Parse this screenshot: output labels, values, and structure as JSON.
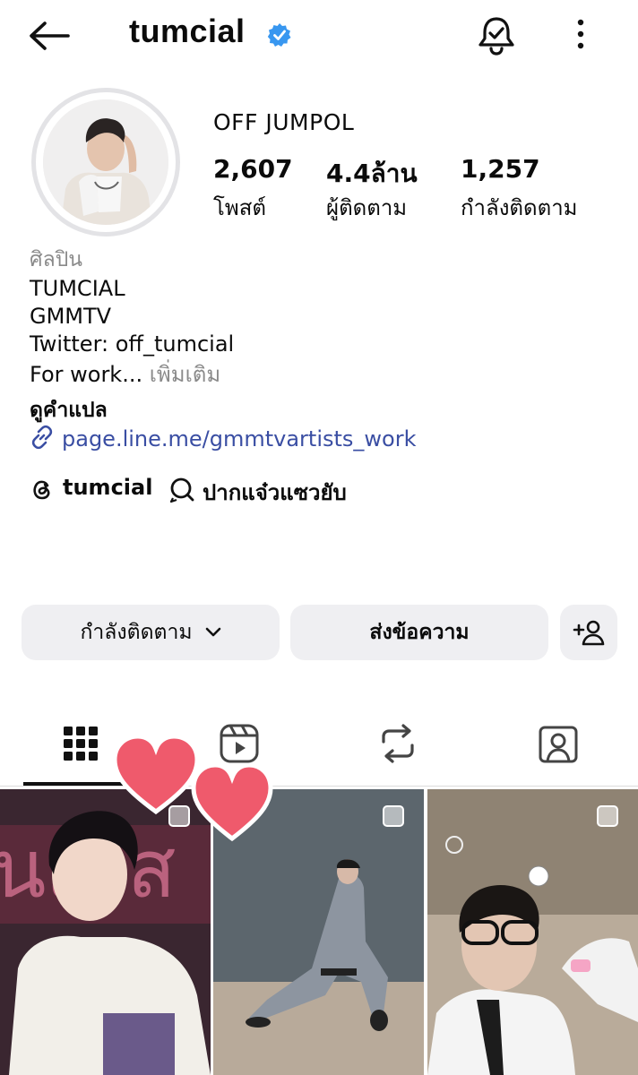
{
  "header": {
    "username": "tumcial",
    "icons": [
      "back-arrow-icon",
      "verified-badge-icon",
      "notification-bell-icon",
      "more-options-icon"
    ]
  },
  "profile": {
    "display_name": "OFF JUMPOL",
    "stats": [
      {
        "value": "2,607",
        "label": "โพสต์"
      },
      {
        "value": "4.4ล้าน",
        "label": "ผู้ติดตาม"
      },
      {
        "value": "1,257",
        "label": "กำลังติดตาม"
      }
    ]
  },
  "bio": {
    "category": "ศิลปิน",
    "lines": [
      "TUMCIAL",
      "GMMTV",
      "Twitter: off_tumcial"
    ],
    "last_line": "For work...",
    "more_label": " เพิ่มเติม",
    "translate_label": "ดูคำแปล",
    "link": "page.line.me/gmmtvartists_work",
    "threads_handle": "tumcial",
    "chat_label": "ปากแจ๋วแซวยับ"
  },
  "actions": {
    "following_label": "กำลังติดตาม",
    "message_label": "ส่งข้อความ",
    "add_user_icon": "add-person-icon"
  },
  "tabs": [
    "grid-icon",
    "reels-icon",
    "reposts-icon",
    "tagged-icon"
  ],
  "colors": {
    "verified": "#3897f0",
    "link": "#3a4ea3",
    "button_bg": "#efeff2",
    "heart": "#ef5a6c"
  }
}
